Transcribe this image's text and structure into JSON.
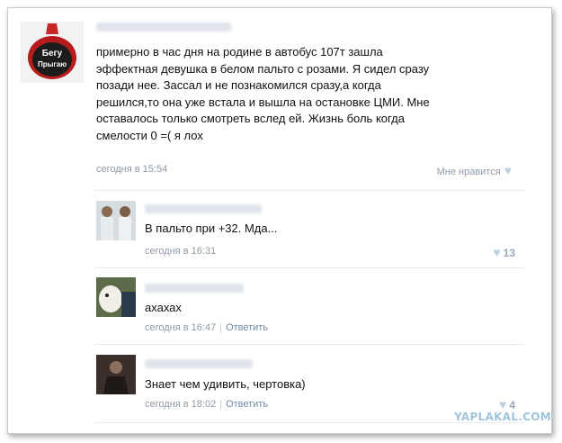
{
  "post": {
    "text": "примерно в час дня на родине в автобус 107т зашла\nэффектная девушка в белом пальто с розами. Я сидел сразу\nпозади нее. Зассал и не познакомился сразу,а когда\nрешился,то она уже встала и вышла на остановке ЦМИ. Мне\nоставалось только смотреть вслед ей. Жизнь боль когда\nсмелости 0 =( я лох",
    "time": "сегодня в 15:54",
    "like_label": "Мне нравится",
    "avatar_text": "Бегу\nПрыгаю"
  },
  "comments": [
    {
      "text": "В пальто при +32. Мда...",
      "time": "сегодня в 16:31",
      "reply": "",
      "likes": "13"
    },
    {
      "text": "ахахах",
      "time": "сегодня в 16:47",
      "reply": "Ответить",
      "likes": ""
    },
    {
      "text": "Знает чем удивить, чертовка)",
      "time": "сегодня в 18:02",
      "reply": "Ответить",
      "likes": "4"
    }
  ],
  "watermark": "YAPLAKAL.COM",
  "colors": {
    "meta": "#8f9aa6",
    "link": "#6f8aa5",
    "heart": "#c2cfdc"
  }
}
